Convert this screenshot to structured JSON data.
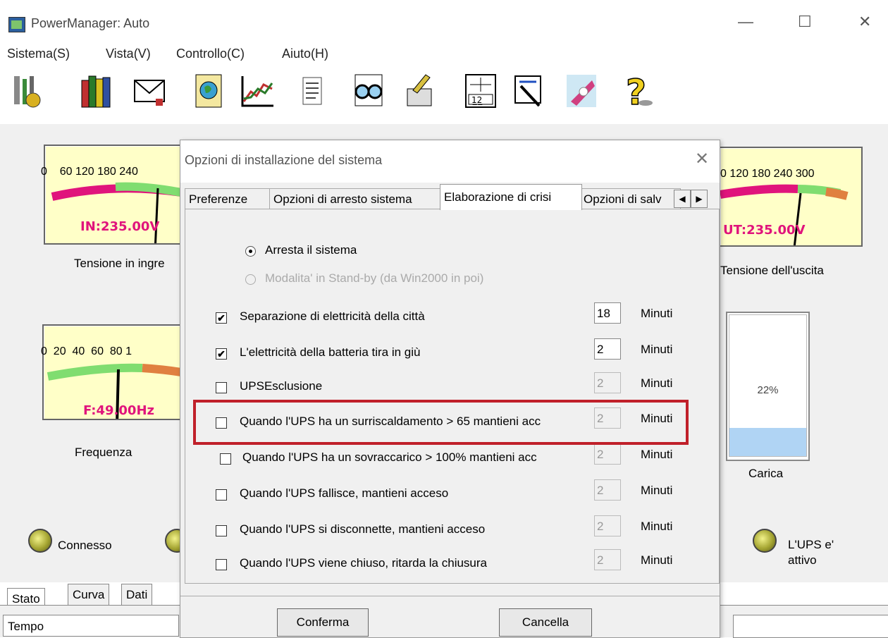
{
  "window": {
    "title": "PowerManager: Auto"
  },
  "window_controls": {
    "minimize": "—",
    "maximize": "☐",
    "close": "✕"
  },
  "menu": [
    "Sistema(S)",
    "Vista(V)",
    "Controllo(C)",
    "Aiuto(H)"
  ],
  "toolbar": [
    {
      "icon": "tools-settings-icon"
    },
    {
      "icon": "books-icon"
    },
    {
      "icon": "envelope-pen-icon"
    },
    {
      "icon": "globe-book-icon"
    },
    {
      "icon": "line-chart-icon"
    },
    {
      "icon": "document-list-icon"
    },
    {
      "icon": "glasses-icon"
    },
    {
      "icon": "brush-icon"
    },
    {
      "icon": "calendar-schedule-icon"
    },
    {
      "icon": "hammer-document-icon"
    },
    {
      "icon": "satellite-icon"
    },
    {
      "icon": "help-icon"
    }
  ],
  "meters": {
    "input": {
      "ticks": [
        "0",
        "60",
        "120",
        "180",
        "240"
      ],
      "readout": "IN:235.00V",
      "label": "Tensione in ingre",
      "value": 235
    },
    "output": {
      "ticks": [
        "0",
        "120",
        "180",
        "240",
        "300"
      ],
      "readout": "UT:235.00V",
      "label": "Tensione dell'uscita",
      "value": 235
    },
    "frequency": {
      "ticks": [
        "0",
        "20",
        "40",
        "60",
        "80",
        "1"
      ],
      "readout": "F:49.00Hz",
      "label": "Frequenza",
      "value": 49
    }
  },
  "charge": {
    "percent_text": "22%",
    "value": 22,
    "label": "Carica"
  },
  "leds": {
    "connected_label": "Connesso",
    "ups_active_label": "L'UPS e' attivo"
  },
  "bottom_tabs": [
    "Stato",
    "Curva",
    "Dati"
  ],
  "status_bar": {
    "time_label": "Tempo"
  },
  "dialog": {
    "title": "Opzioni di installazione del sistema",
    "close": "✕",
    "tabs": [
      "Preferenze",
      "Opzioni di arresto sistema",
      "Elaborazione di crisi",
      "Opzioni di salv"
    ],
    "active_tab": "Elaborazione di crisi",
    "radios": [
      {
        "label": "Arresta il sistema",
        "selected": true,
        "enabled": true
      },
      {
        "label": "Modalita' in Stand-by (da Win2000 in poi)",
        "selected": false,
        "enabled": false
      }
    ],
    "options": [
      {
        "label": "Separazione di elettricità della città",
        "checked": true,
        "value": "18",
        "unit": "Minuti"
      },
      {
        "label": "L'elettricità della batteria tira in giù",
        "checked": true,
        "value": "2",
        "unit": "Minuti"
      },
      {
        "label": "UPSEsclusione",
        "checked": false,
        "value": "2",
        "unit": "Minuti"
      },
      {
        "label": "Quando l'UPS ha un surriscaldamento > 65 mantieni acc",
        "checked": false,
        "value": "2",
        "unit": "Minuti"
      },
      {
        "label": "Quando l'UPS ha un sovraccarico > 100% mantieni acc",
        "checked": false,
        "value": "2",
        "unit": "Minuti"
      },
      {
        "label": "Quando l'UPS fallisce, mantieni acceso",
        "checked": false,
        "value": "2",
        "unit": "Minuti"
      },
      {
        "label": "Quando l'UPS si disconnette, mantieni acceso",
        "checked": false,
        "value": "2",
        "unit": "Minuti"
      },
      {
        "label": "Quando l'UPS viene chiuso, ritarda la chiusura",
        "checked": false,
        "value": "2",
        "unit": "Minuti"
      }
    ],
    "confirm_label": "Conferma",
    "cancel_label": "Cancella"
  },
  "colors": {
    "highlight": "#c0202a",
    "readout": "#e0147c",
    "meter_face": "#ffffc8",
    "charge_fill": "#b0d4f4"
  }
}
